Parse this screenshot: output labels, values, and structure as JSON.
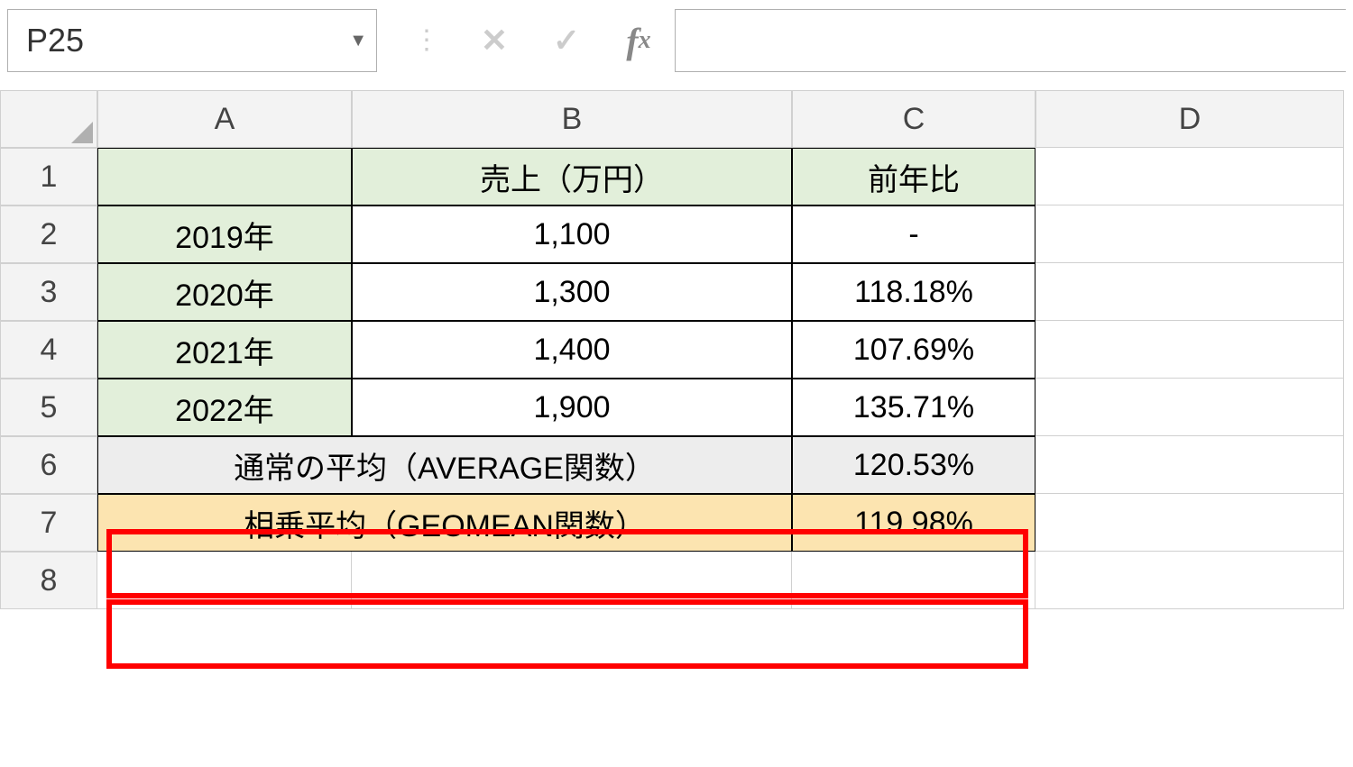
{
  "nameBox": "P25",
  "columnHeaders": [
    "A",
    "B",
    "C",
    "D"
  ],
  "rowHeaders": [
    "1",
    "2",
    "3",
    "4",
    "5",
    "6",
    "7",
    "8"
  ],
  "cells": {
    "A1": "",
    "B1": "売上（万円）",
    "C1": "前年比",
    "A2": "2019年",
    "B2": "1,100",
    "C2": "-",
    "A3": "2020年",
    "B3": "1,300",
    "C3": "118.18%",
    "A4": "2021年",
    "B4": "1,400",
    "C4": "107.69%",
    "A5": "2022年",
    "B5": "1,900",
    "C5": "135.71%",
    "AB6": "通常の平均（AVERAGE関数）",
    "C6": "120.53%",
    "AB7": "相乗平均（GEOMEAN関数）",
    "C7": "119.98%"
  }
}
